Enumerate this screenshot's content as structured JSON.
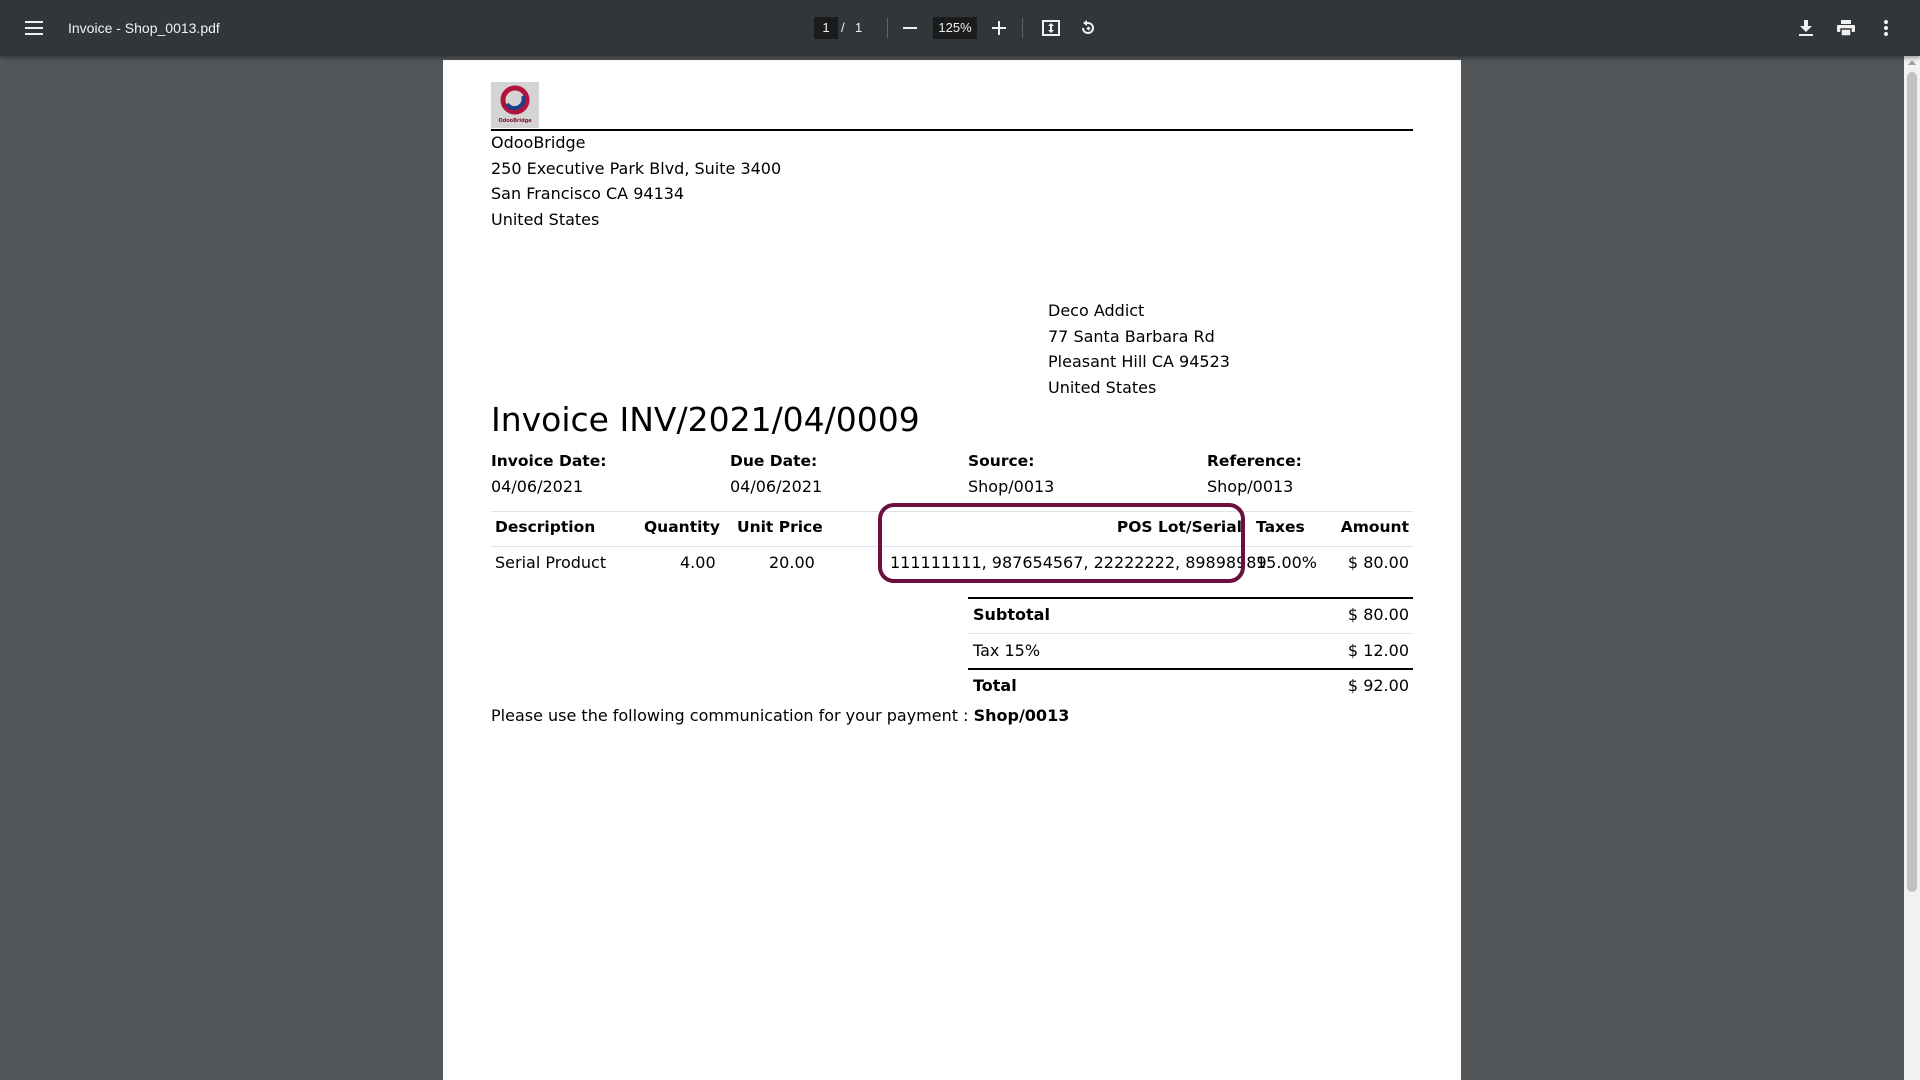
{
  "toolbar": {
    "title": "Invoice - Shop_0013.pdf",
    "current_page": "1",
    "page_separator": "/",
    "total_pages": "1",
    "zoom": "125%",
    "icons": {
      "menu": "hamburger-menu-icon",
      "zoom_out": "minus-icon",
      "zoom_in": "plus-icon",
      "fit": "fit-to-page-icon",
      "rotate": "rotate-counterclockwise-icon",
      "download": "download-icon",
      "print": "print-icon",
      "more": "more-vertical-icon"
    }
  },
  "invoice": {
    "logo_text": "OdooBridge",
    "company": {
      "name": "OdooBridge",
      "street": "250 Executive Park Blvd, Suite 3400",
      "city": "San Francisco CA 94134",
      "country": "United States"
    },
    "partner": {
      "name": "Deco Addict",
      "street": "77 Santa Barbara Rd",
      "city": "Pleasant Hill CA 94523",
      "country": "United States"
    },
    "title": "Invoice INV/2021/04/0009",
    "info": {
      "invoice_date_label": "Invoice Date:",
      "invoice_date": "04/06/2021",
      "due_date_label": "Due Date:",
      "due_date": "04/06/2021",
      "source_label": "Source:",
      "source": "Shop/0013",
      "reference_label": "Reference:",
      "reference": "Shop/0013"
    },
    "lines_header": {
      "description": "Description",
      "quantity": "Quantity",
      "unit_price": "Unit Price",
      "lot_serial": "POS Lot/Serial",
      "taxes": "Taxes",
      "amount": "Amount"
    },
    "lines": [
      {
        "description": "Serial Product",
        "quantity": "4.00",
        "unit_price": "20.00",
        "lot_serial": "111111111, 987654567, 22222222, 89898989",
        "taxes": "15.00%",
        "amount": "$ 80.00"
      }
    ],
    "totals": {
      "subtotal_label": "Subtotal",
      "subtotal": "$ 80.00",
      "tax_label": "Tax 15%",
      "tax": "$ 12.00",
      "total_label": "Total",
      "total": "$ 92.00"
    },
    "payment_text": "Please use the following communication for your payment :",
    "payment_ref": "Shop/0013",
    "highlight_color": "#6b0f3e"
  }
}
